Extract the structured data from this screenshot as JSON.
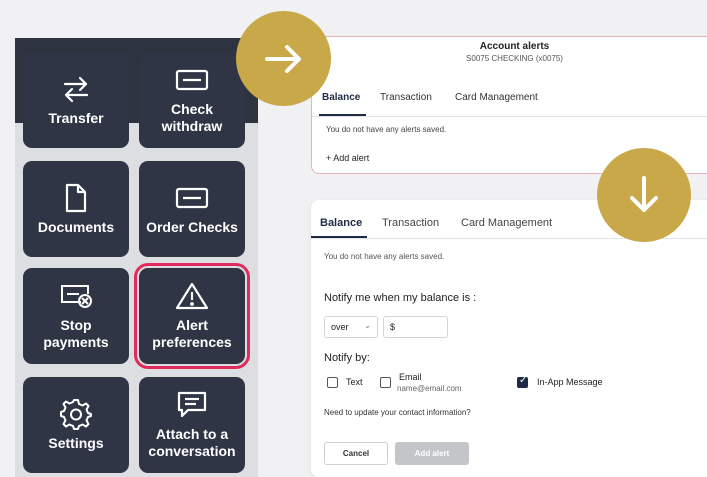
{
  "tiles": [
    {
      "label": "Transfer",
      "icon": "transfer-icon"
    },
    {
      "label": "Check\nwithdraw",
      "icon": "check-icon"
    },
    {
      "label": "Documents",
      "icon": "document-icon"
    },
    {
      "label": "Order Checks",
      "icon": "check-icon"
    },
    {
      "label": "Stop\npayments",
      "icon": "stop-payment-icon"
    },
    {
      "label": "Alert\npreferences",
      "icon": "warning-icon"
    },
    {
      "label": "Settings",
      "icon": "gear-icon"
    },
    {
      "label": "Attach to a\nconversation",
      "icon": "chat-icon"
    }
  ],
  "alerts_card": {
    "title": "Account alerts",
    "subtitle": "S0075 CHECKING (x0075)",
    "tabs": [
      "Balance",
      "Transaction",
      "Card Management"
    ],
    "empty_text": "You do not have any alerts saved.",
    "add_label": "+ Add alert"
  },
  "form_card": {
    "tabs": [
      "Balance",
      "Transaction",
      "Card Management"
    ],
    "empty_text": "You do not have any alerts saved.",
    "notify_balance_label": "Notify me when my balance is :",
    "condition_value": "over",
    "amount_prefix": "$",
    "notify_by_label": "Notify by:",
    "text_option": "Text",
    "email_option": "Email",
    "email_value": "name@email.com",
    "inapp_option": "In-App Message",
    "contact_text": "Need to update your contact information?",
    "cancel_label": "Cancel",
    "add_label": "Add alert"
  },
  "colors": {
    "accent": "#c9a84a",
    "highlight": "#e02a5d",
    "tile": "#2f3545"
  }
}
